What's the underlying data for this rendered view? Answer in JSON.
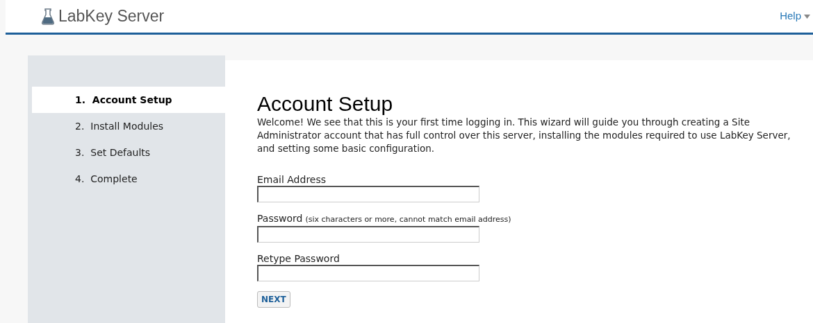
{
  "header": {
    "brand": "LabKey Server",
    "help": "Help"
  },
  "steps": [
    {
      "label": "1.  Account Setup",
      "selected": true
    },
    {
      "label": "2.  Install Modules",
      "selected": false
    },
    {
      "label": "3.  Set Defaults",
      "selected": false
    },
    {
      "label": "4.  Complete",
      "selected": false
    }
  ],
  "title": "Account Setup",
  "intro": "Welcome! We see that this is your first time logging in. This wizard will guide you through creating a Site Administrator account that has full control over this server, installing the modules required to use LabKey Server, and setting some basic configuration.",
  "fields": [
    {
      "label": "Email Address"
    },
    {
      "label": "Password",
      "hint": "(six characters or more, cannot match email address)"
    },
    {
      "label": "Retype Password"
    }
  ],
  "button": "NEXT"
}
